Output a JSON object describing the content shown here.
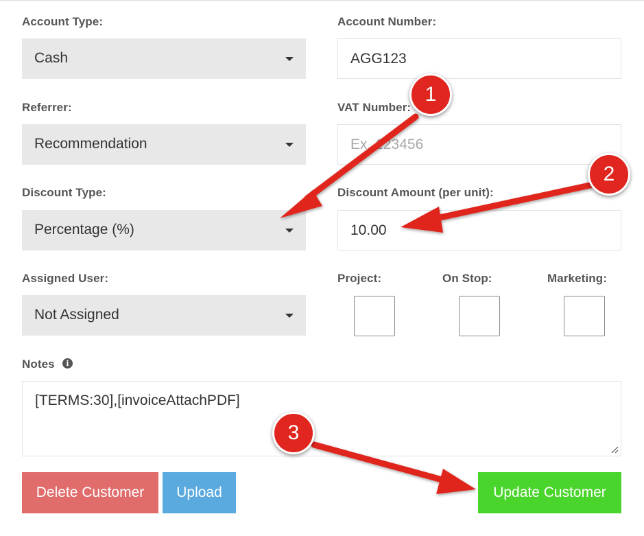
{
  "form": {
    "account_type": {
      "label": "Account Type:",
      "value": "Cash"
    },
    "account_number": {
      "label": "Account Number:",
      "value": "AGG123"
    },
    "referrer": {
      "label": "Referrer:",
      "value": "Recommendation"
    },
    "vat_number": {
      "label": "VAT Number:",
      "placeholder": "Ex. 123456"
    },
    "discount_type": {
      "label": "Discount Type:",
      "value": "Percentage (%)"
    },
    "discount_amount": {
      "label": "Discount Amount (per unit):",
      "value": "10.00"
    },
    "assigned_user": {
      "label": "Assigned User:",
      "value": "Not Assigned"
    },
    "checkboxes": {
      "project": {
        "label": "Project:",
        "checked": false
      },
      "on_stop": {
        "label": "On Stop:",
        "checked": false
      },
      "marketing": {
        "label": "Marketing:",
        "checked": false
      }
    },
    "notes": {
      "label": "Notes",
      "value": "[TERMS:30],[invoiceAttachPDF]"
    }
  },
  "buttons": {
    "delete": {
      "label": "Delete Customer",
      "color": "#e06c6c"
    },
    "upload": {
      "label": "Upload",
      "color": "#5aaae0"
    },
    "update": {
      "label": "Update Customer",
      "color": "#4ad52c"
    }
  },
  "annotations": {
    "color": "#e0261e",
    "badges": [
      "1",
      "2",
      "3"
    ]
  },
  "icons": {
    "info": "info-circle-icon",
    "caret": "caret-down-icon",
    "resize": "resize-grip-icon"
  }
}
